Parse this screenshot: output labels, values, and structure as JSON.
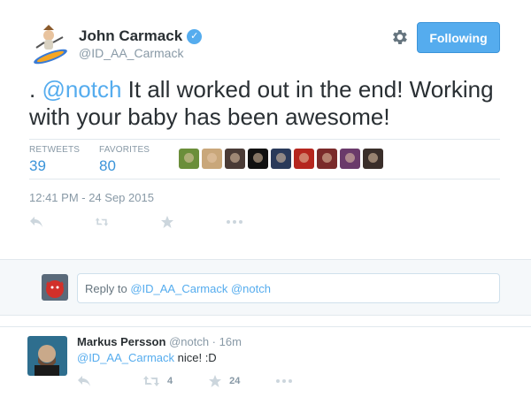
{
  "tweet": {
    "author_name": "John Carmack",
    "author_handle": "@ID_AA_Carmack",
    "verified_mark": "✓",
    "follow_label": "Following",
    "text_prefix": ". ",
    "text_mention": "@notch",
    "text_body": " It all worked out in the end! Working with your baby has been awesome!",
    "retweets_label": "RETWEETS",
    "retweets_count": "39",
    "favorites_label": "FAVORITES",
    "favorites_count": "80",
    "timestamp": "12:41 PM - 24 Sep 2015",
    "favoriter_avatar_colors": [
      "#6b8e3a",
      "#c9a77a",
      "#4a3b36",
      "#111111",
      "#2a3a5a",
      "#b5261e",
      "#7a2a2a",
      "#6a3a6a",
      "#3a2e2a"
    ]
  },
  "reply": {
    "placeholder_prefix": "Reply to ",
    "placeholder_mention": "@ID_AA_Carmack @notch"
  },
  "reply_tweet": {
    "author_name": "Markus Persson",
    "meta": "@notch · 16m",
    "text_mention": "@ID_AA_Carmack",
    "text_body": " nice! :D",
    "retweet_count": "4",
    "favorite_count": "24"
  },
  "colors": {
    "accent": "#55acee",
    "muted": "#8899a6",
    "icon": "#ccd6dd",
    "panel": "#f5f8fa"
  }
}
